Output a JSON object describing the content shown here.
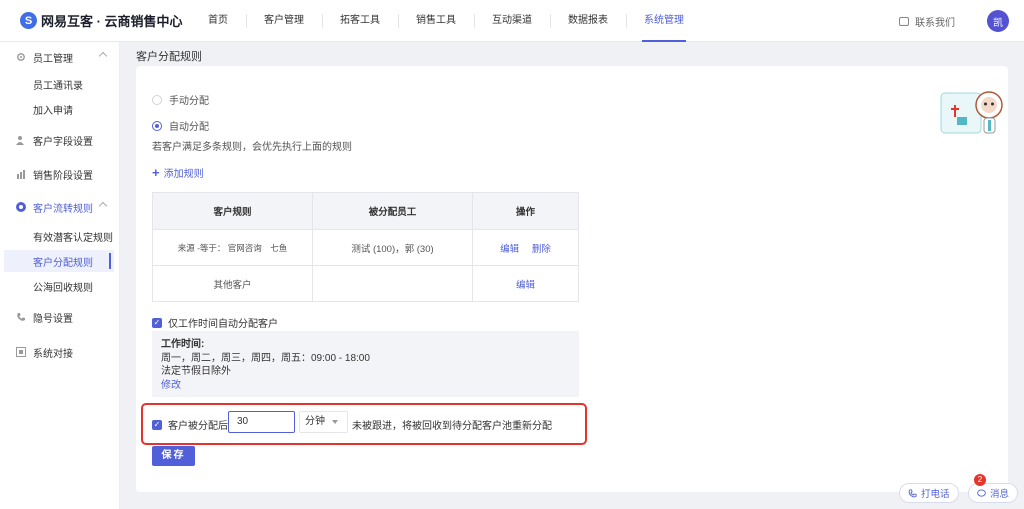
{
  "brand": {
    "name": "网易互客 · 云商销售中心",
    "logo_letter": "S"
  },
  "nav": [
    "首页",
    "客户管理",
    "拓客工具",
    "销售工具",
    "互动渠道",
    "数据报表",
    "系统管理"
  ],
  "nav_active": "系统管理",
  "header": {
    "contact": "联系我们",
    "avatar": "凯"
  },
  "sidebar": {
    "staff": "员工管理",
    "staff_directory": "员工通讯录",
    "join_requests": "加入申请",
    "customer_fields": "客户字段设置",
    "sales_stage": "销售阶段设置",
    "customer_flow": "客户流转规则",
    "potential_rule": "有效潜客认定规则",
    "assign_rule": "客户分配规则",
    "pool_rule": "公海回收规则",
    "privacy": "隐号设置",
    "integration": "系统对接"
  },
  "page": {
    "title": "客户分配规则",
    "manual": "手动分配",
    "auto": "自动分配",
    "hint": "若客户满足多条规则，会优先执行上面的规则",
    "add_rule": "添加规则",
    "table": {
      "headers": [
        "客户规则",
        "被分配员工",
        "操作"
      ],
      "rows": [
        {
          "rule_prefix": "来源 -等于：",
          "rule_values": "官网咨询　七鱼",
          "staff": "测试 (100)，郭 (30)",
          "actions": [
            "编辑",
            "删除"
          ]
        },
        {
          "rule_prefix": "其他客户",
          "rule_values": "",
          "staff": "",
          "actions": [
            "编辑"
          ]
        }
      ]
    },
    "work_only": "仅工作时间自动分配客户",
    "work_time": {
      "title": "工作时间:",
      "days": "周一，周二，周三，周四，周五：09:00 - 18:00",
      "holiday": "法定节假日除外",
      "edit": "修改"
    },
    "reassign": {
      "label": "客户被分配后",
      "value": "30",
      "unit": "分钟",
      "after": "未被跟进，将被回收到待分配客户池重新分配"
    },
    "save": "保存"
  },
  "floating": {
    "call": "打电话",
    "message": "消息",
    "badge": "2"
  },
  "colors": {
    "accent": "#5160d8",
    "highlight": "#e5342b"
  }
}
